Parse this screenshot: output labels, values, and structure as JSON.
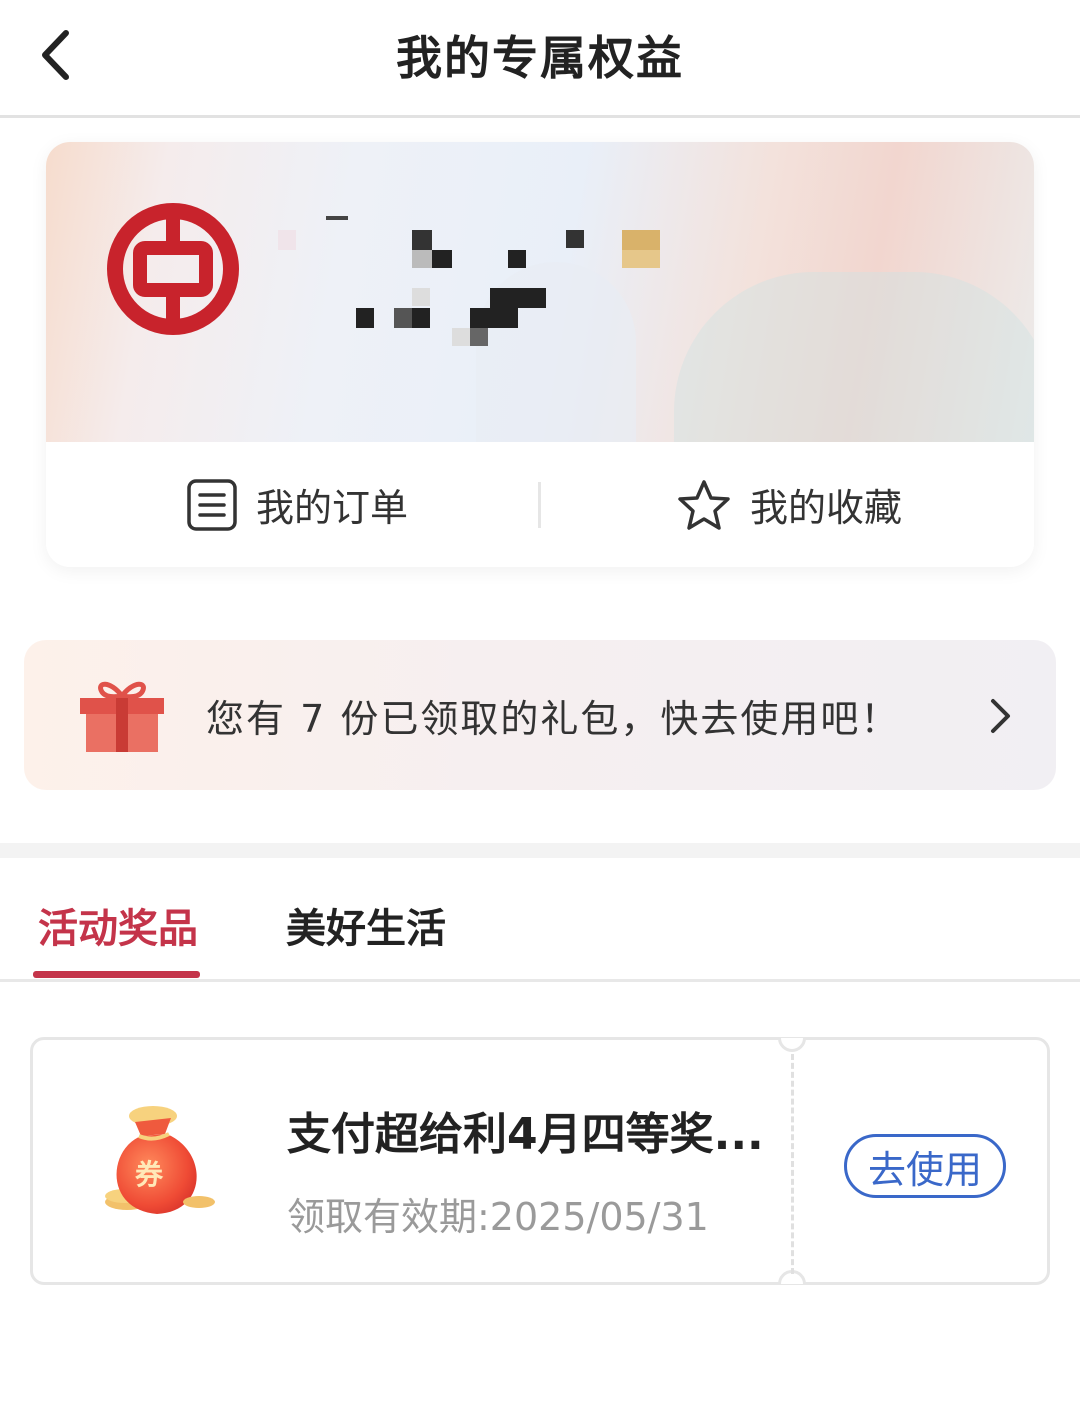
{
  "header": {
    "title": "我的专属权益",
    "back_icon": "chevron-left-icon"
  },
  "profile": {
    "logo_icon": "bank-of-china-logo-icon",
    "username_obscured": true
  },
  "quick_actions": {
    "orders_label": "我的订单",
    "orders_icon": "order-list-icon",
    "favorites_label": "我的收藏",
    "favorites_icon": "star-icon"
  },
  "gift_banner": {
    "text": "您有 7 份已领取的礼包，快去使用吧！",
    "gift_count": 7,
    "icon": "gift-icon",
    "chevron_icon": "chevron-right-icon"
  },
  "tabs": [
    {
      "label": "活动奖品",
      "active": true
    },
    {
      "label": "美好生活",
      "active": false
    }
  ],
  "prizes": [
    {
      "title": "支付超给利4月四等奖...",
      "validity": "领取有效期:2025/05/31",
      "icon": "coupon-bag-icon",
      "icon_text": "券",
      "action_label": "去使用"
    }
  ],
  "colors": {
    "accent_red": "#c4344a",
    "action_blue": "#3a68c9",
    "logo_red": "#c8232c"
  }
}
